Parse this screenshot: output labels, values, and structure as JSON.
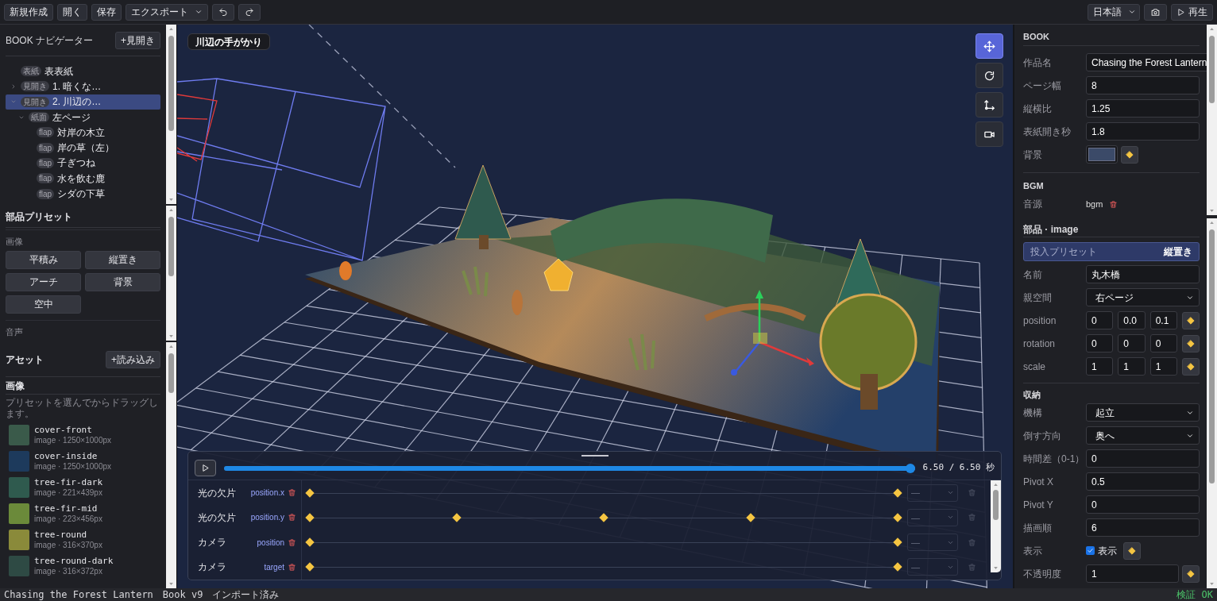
{
  "toolbar": {
    "buttons": [
      "新規作成",
      "開く",
      "保存"
    ],
    "export_menu": "エクスポート",
    "language": "日本語",
    "play_button": "再生"
  },
  "navigator": {
    "title": "BOOK ナビゲーター",
    "add_button": "+見開き",
    "items": [
      {
        "tag": "表紙",
        "label": "表表紙",
        "selected": false
      },
      {
        "tag": "見開き",
        "label": "1. 暗くな…",
        "selected": false,
        "expanded": false
      },
      {
        "tag": "見開き",
        "label": "2. 川辺の…",
        "selected": true,
        "expanded": true,
        "children": [
          {
            "tag": "紙面",
            "label": "左ページ",
            "selected": false,
            "expanded": true,
            "children": [
              {
                "tag": "flap",
                "label": "対岸の木立",
                "selected": false
              },
              {
                "tag": "flap",
                "label": "岸の草（左）",
                "selected": false
              },
              {
                "tag": "flap",
                "label": "子ぎつね",
                "selected": false
              },
              {
                "tag": "flap",
                "label": "水を飲む鹿",
                "selected": false
              },
              {
                "tag": "flap",
                "label": "シダの下草",
                "selected": false
              }
            ]
          }
        ]
      }
    ]
  },
  "presets": {
    "title": "部品プリセット",
    "groups": [
      {
        "label": "画像",
        "buttons": [
          "平積み",
          "縦置き",
          "アーチ",
          "背景",
          "空中"
        ]
      },
      {
        "label": "音声"
      }
    ]
  },
  "assets": {
    "title": "アセット",
    "import_button": "+読み込み",
    "section": "画像",
    "hint": "プリセットを選んでからドラッグします。",
    "items": [
      {
        "name": "cover-front",
        "meta": "image · 1250×1000px",
        "color": "#3a5a4a"
      },
      {
        "name": "cover-inside",
        "meta": "image · 1250×1000px",
        "color": "#1d3a5c"
      },
      {
        "name": "tree-fir-dark",
        "meta": "image · 221×439px",
        "color": "#2f5a4e"
      },
      {
        "name": "tree-fir-mid",
        "meta": "image · 223×456px",
        "color": "#6b8a3a"
      },
      {
        "name": "tree-round",
        "meta": "image · 316×370px",
        "color": "#8a8a3a"
      },
      {
        "name": "tree-round-dark",
        "meta": "image · 316×372px",
        "color": "#2e4a44"
      }
    ]
  },
  "viewport": {
    "label": "川辺の手がかり",
    "tools": [
      {
        "kind": "move",
        "selected": true
      },
      {
        "kind": "rotate",
        "selected": false
      },
      {
        "kind": "axes",
        "selected": false
      },
      {
        "kind": "camera",
        "selected": false
      }
    ]
  },
  "timeline": {
    "level": 1,
    "time": "6.50 / 6.50 秒",
    "tracks": [
      {
        "target": "光の欠片",
        "property": "position.x",
        "easing": "—",
        "keyframes": [
          {
            "selected": false
          },
          {
            "selected": false
          }
        ]
      },
      {
        "target": "光の欠片",
        "property": "position.y",
        "easing": "—",
        "keyframes": [
          {
            "selected": false
          },
          {
            "selected": false
          },
          {
            "selected": false
          },
          {
            "selected": false
          },
          {
            "selected": false
          }
        ]
      },
      {
        "target": "カメラ",
        "property": "position",
        "easing": "—",
        "keyframes": [
          {
            "selected": false
          },
          {
            "selected": false
          }
        ]
      },
      {
        "target": "カメラ",
        "property": "target",
        "easing": "—",
        "keyframes": [
          {
            "selected": false
          },
          {
            "selected": false
          }
        ]
      }
    ]
  },
  "book_panel": {
    "title": "BOOK",
    "fields": [
      {
        "kind": "text",
        "label": "作品名",
        "value": "Chasing the Forest Lantern",
        "keyable": false
      },
      {
        "kind": "text",
        "label": "ページ幅",
        "value": "8",
        "keyable": false
      },
      {
        "kind": "text",
        "label": "縦横比",
        "value": "1.25",
        "keyable": false
      },
      {
        "kind": "text",
        "label": "表紙開き秒",
        "value": "1.8",
        "keyable": false
      },
      {
        "kind": "color",
        "label": "背景",
        "color": "#3b4a68",
        "keyable": true
      }
    ],
    "bgm": {
      "title": "BGM",
      "fields": [
        {
          "kind": "file",
          "label": "音源",
          "value": "bgm",
          "keyable": false
        }
      ]
    }
  },
  "part_panel": {
    "title": "部品 · image",
    "preset_label": "投入プリセット",
    "preset_value": "縦置き",
    "fields": [
      {
        "kind": "text",
        "label": "名前",
        "value": "丸木橋",
        "keyable": false
      },
      {
        "kind": "select",
        "label": "親空間",
        "value": "右ページ",
        "keyable": false
      },
      {
        "kind": "vec3",
        "label": "position",
        "values": [
          "0",
          "0.0",
          "0.1"
        ],
        "keyable": true
      },
      {
        "kind": "vec3",
        "label": "rotation",
        "values": [
          "0",
          "0",
          "0"
        ],
        "keyable": true
      },
      {
        "kind": "vec3",
        "label": "scale",
        "values": [
          "1",
          "1",
          "1"
        ],
        "keyable": true
      }
    ],
    "storage": {
      "title": "収納",
      "fields": [
        {
          "kind": "select",
          "label": "機構",
          "value": "起立",
          "keyable": false
        },
        {
          "kind": "select",
          "label": "倒す方向",
          "value": "奥へ",
          "keyable": false
        },
        {
          "kind": "text",
          "label": "時間差（0-1）",
          "value": "0",
          "keyable": false
        },
        {
          "kind": "text",
          "label": "Pivot X",
          "value": "0.5",
          "keyable": false
        },
        {
          "kind": "text",
          "label": "Pivot Y",
          "value": "0",
          "keyable": false
        },
        {
          "kind": "text",
          "label": "描画順",
          "value": "6",
          "keyable": false
        },
        {
          "kind": "checkbox",
          "label": "表示",
          "text": "表示",
          "checked": true,
          "keyable": true
        },
        {
          "kind": "text",
          "label": "不透明度",
          "value": "1",
          "keyable": true
        }
      ]
    }
  },
  "status_bar": {
    "items": [
      "Chasing the Forest Lantern",
      "Book v9",
      "インポート済み"
    ],
    "validation": "検証 OK"
  }
}
